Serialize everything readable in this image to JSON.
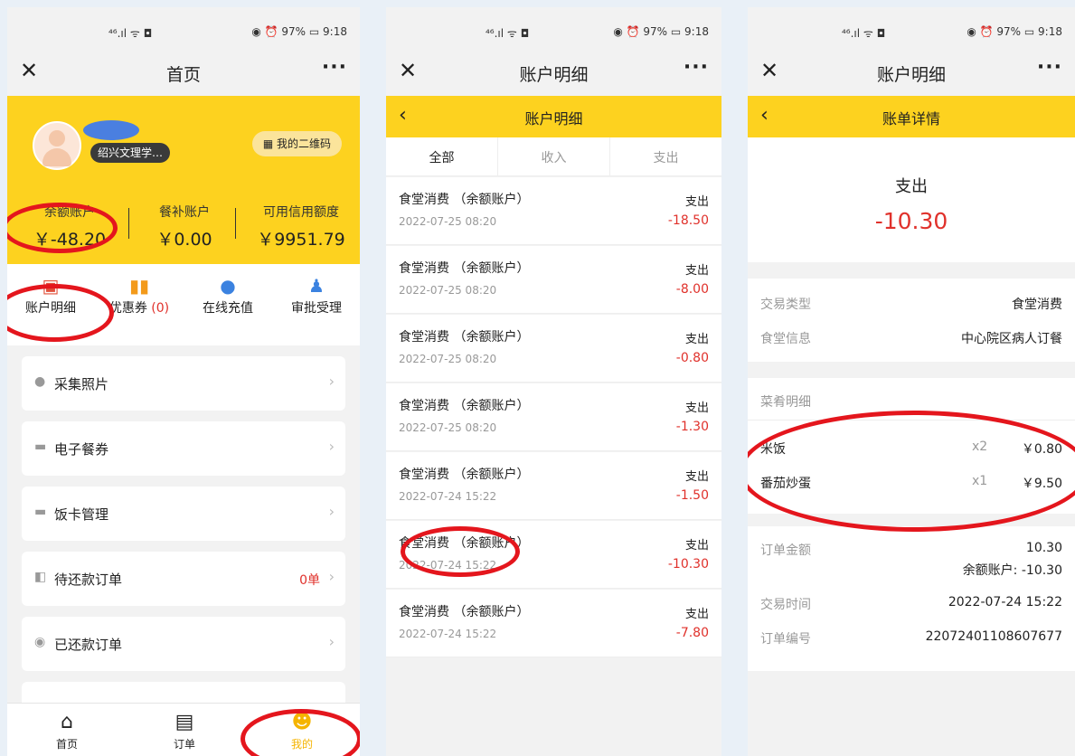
{
  "status": {
    "signal": "⁴⁶.ıl ᯤ ◘",
    "right": "◉ ⏰ 97% ▭ 9:18"
  },
  "p1": {
    "title": "首页",
    "school": "绍兴文理学…",
    "qr": "我的二维码",
    "balances": [
      {
        "label": "余额账户",
        "value": "￥-48.20"
      },
      {
        "label": "餐补账户",
        "value": "￥0.00"
      },
      {
        "label": "可用信用额度",
        "value": "￥9951.79"
      }
    ],
    "actions": [
      {
        "label": "账户明细"
      },
      {
        "label": "优惠券",
        "count": "(0)"
      },
      {
        "label": "在线充值"
      },
      {
        "label": "审批受理"
      }
    ],
    "menu": [
      {
        "label": "采集照片"
      },
      {
        "label": "电子餐券"
      },
      {
        "label": "饭卡管理"
      },
      {
        "label": "待还款订单",
        "count": "0单"
      },
      {
        "label": "已还款订单"
      }
    ],
    "tabs": [
      {
        "label": "首页"
      },
      {
        "label": "订单"
      },
      {
        "label": "我的"
      }
    ]
  },
  "p2": {
    "title": "账户明细",
    "subtitle": "账户明细",
    "filters": [
      "全部",
      "收入",
      "支出"
    ],
    "txns": [
      {
        "name": "食堂消费 （余额账户）",
        "date": "2022-07-25 08:20",
        "kind": "支出",
        "amount": "-18.50"
      },
      {
        "name": "食堂消费 （余额账户）",
        "date": "2022-07-25 08:20",
        "kind": "支出",
        "amount": "-8.00"
      },
      {
        "name": "食堂消费 （余额账户）",
        "date": "2022-07-25 08:20",
        "kind": "支出",
        "amount": "-0.80"
      },
      {
        "name": "食堂消费 （余额账户）",
        "date": "2022-07-25 08:20",
        "kind": "支出",
        "amount": "-1.30"
      },
      {
        "name": "食堂消费 （余额账户）",
        "date": "2022-07-24 15:22",
        "kind": "支出",
        "amount": "-1.50"
      },
      {
        "name": "食堂消费 （余额账户）",
        "date": "2022-07-24 15:22",
        "kind": "支出",
        "amount": "-10.30"
      },
      {
        "name": "食堂消费 （余额账户）",
        "date": "2022-07-24 15:22",
        "kind": "支出",
        "amount": "-7.80"
      }
    ]
  },
  "p3": {
    "title": "账户明细",
    "subtitle": "账单详情",
    "kind": "支出",
    "amount": "-10.30",
    "type_label": "交易类型",
    "type_value": "食堂消费",
    "canteen_label": "食堂信息",
    "canteen_value": "中心院区病人订餐",
    "dishes_label": "菜肴明细",
    "dishes": [
      {
        "name": "米饭",
        "qty": "x2",
        "price": "￥0.80"
      },
      {
        "name": "番茄炒蛋",
        "qty": "x1",
        "price": "￥9.50"
      }
    ],
    "order_amount_label": "订单金额",
    "order_amount": "10.30",
    "balance_deduct": "余额账户:  -10.30",
    "time_label": "交易时间",
    "time_value": "2022-07-24 15:22",
    "no_label": "订单编号",
    "no_value": "22072401108607677"
  },
  "colors": {
    "accent": "#fdd21f",
    "negative": "#e0312b",
    "annotation": "#e4161d"
  }
}
